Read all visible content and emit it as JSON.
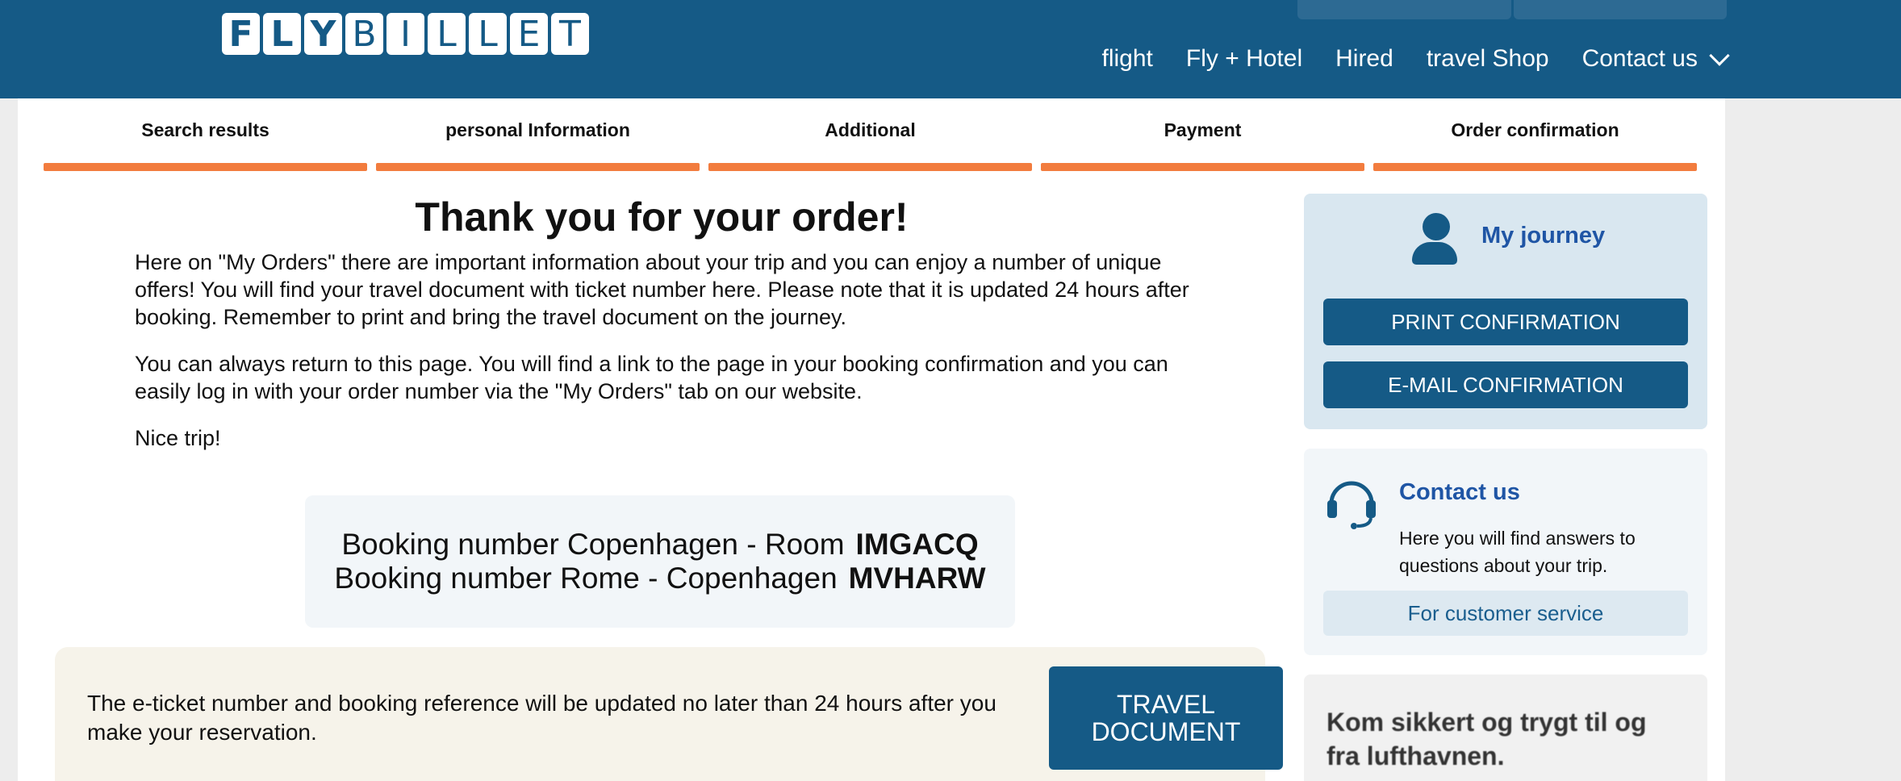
{
  "header": {
    "logo_letters": [
      "F",
      "L",
      "Y",
      "B",
      "I",
      "L",
      "L",
      "E",
      "T"
    ],
    "nav": [
      "flight",
      "Fly + Hotel",
      "Hired",
      "travel Shop",
      "Contact us"
    ]
  },
  "steps": [
    "Search results",
    "personal Information",
    "Additional",
    "Payment",
    "Order confirmation"
  ],
  "main": {
    "title": "Thank you for your order!",
    "para1": "Here on \"My Orders\" there are important information about your trip and you can enjoy a number of unique offers! You will find your travel document with ticket number here. Please note that it is updated 24 hours after booking. Remember to print and bring the travel document on the journey.",
    "para2": "You can always return to this page. You will find a link to the page in your booking confirmation and you can easily log in with your order number via the \"My Orders\" tab on our website.",
    "para3": "Nice trip!",
    "bookings": [
      {
        "label": "Booking number Copenhagen - Room",
        "code": "IMGACQ"
      },
      {
        "label": "Booking number Rome - Copenhagen",
        "code": "MVHARW"
      }
    ],
    "notice_text": "The e-ticket number and booking reference will be updated no later than 24 hours after you make your reservation.",
    "travel_doc_line1": "TRAVEL",
    "travel_doc_line2": "DOCUMENT"
  },
  "sidebar": {
    "journey_title": "My journey",
    "print_label": "PRINT CONFIRMATION",
    "email_label": "E-MAIL CONFIRMATION",
    "contact_title": "Contact us",
    "contact_text": "Here you will find answers to questions about your trip.",
    "customer_service_label": "For customer service",
    "promo_text": "Kom sikkert og trygt til og fra lufthavnen."
  },
  "colors": {
    "brand": "#155a86",
    "step_bar": "#f27c3e",
    "link": "#1f55a5",
    "notice_bg": "#f6f3ea"
  }
}
